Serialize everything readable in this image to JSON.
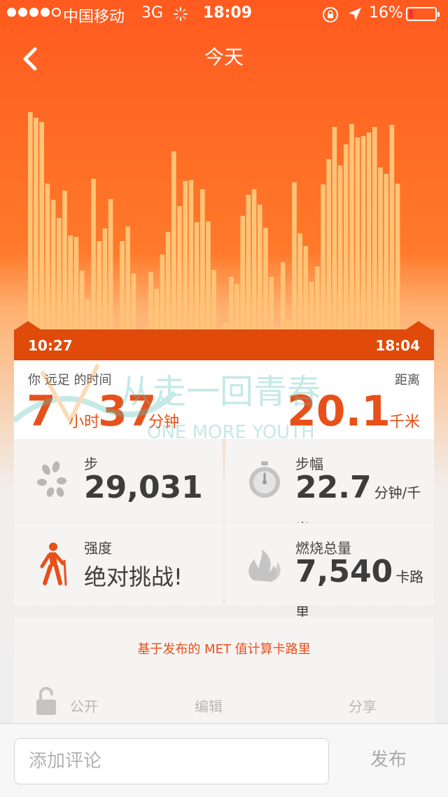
{
  "status_bar": {
    "carrier": "中国移动",
    "network": "3G",
    "time": "18:09",
    "battery": "16%",
    "battery_level": 0.16,
    "signal_bars": 4
  },
  "nav": {
    "title": "今天",
    "back_icon": "chevron-left-icon"
  },
  "timeline": {
    "start": "10:27",
    "end": "18:04"
  },
  "chart_data": {
    "type": "bar",
    "values": [
      310,
      302,
      296,
      208,
      185,
      159,
      198,
      134,
      132,
      84,
      43,
      215,
      126,
      144,
      186,
      0,
      126,
      147,
      80,
      0,
      0,
      82,
      58,
      107,
      139,
      254,
      176,
      212,
      213,
      153,
      200,
      154,
      85,
      0,
      10,
      75,
      65,
      162,
      192,
      200,
      178,
      145,
      75,
      3,
      96,
      14,
      210,
      137,
      119,
      68,
      90,
      207,
      243,
      289,
      234,
      264,
      293,
      274,
      276,
      281,
      289,
      231,
      222,
      292,
      208
    ],
    "color": "#ffc477"
  },
  "summary": {
    "time_label": "你 远足 的时间",
    "hours": "7",
    "hours_unit": "小时",
    "minutes": "37",
    "minutes_unit": "分钟",
    "distance_label": "距离",
    "distance": "20.1",
    "distance_unit": "千米"
  },
  "watermark": {
    "cn": "从走一回青春",
    "en": "ONE MORE YOUTH"
  },
  "stats": {
    "steps": {
      "label": "步",
      "value": "29,031",
      "icon": "footprint-icon"
    },
    "pace": {
      "label": "步幅",
      "value": "22.7",
      "unit": "分钟/千米",
      "icon": "stopwatch-icon"
    },
    "intensity": {
      "label": "强度",
      "value": "绝对挑战!",
      "icon": "hiker-icon"
    },
    "calories": {
      "label": "燃烧总量",
      "value": "7,540",
      "unit": "卡路里",
      "icon": "flame-icon"
    }
  },
  "note": "基于发布的 MET 值计算卡路里",
  "actions": {
    "public": "公开",
    "edit": "编辑",
    "share": "分享"
  },
  "comment": {
    "placeholder": "添加评论",
    "publish": "发布"
  },
  "colors": {
    "accent": "#e8501a",
    "header": "#ff5a1f",
    "timeline": "#e04a0a"
  }
}
